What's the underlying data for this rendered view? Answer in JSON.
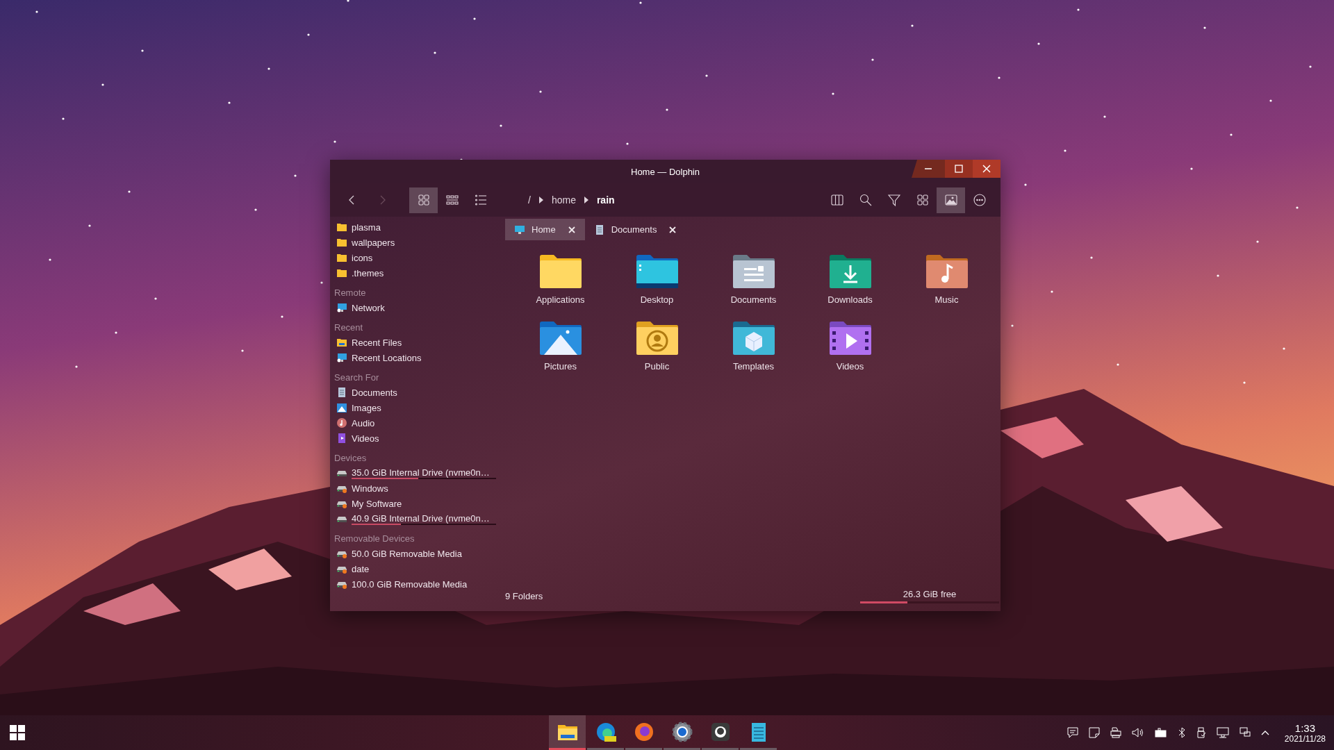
{
  "window": {
    "title": "Home — Dolphin"
  },
  "toolbar": {
    "view_modes": [
      {
        "kind": "icons",
        "selected": true
      },
      {
        "kind": "compact",
        "selected": false
      },
      {
        "kind": "details",
        "selected": false
      }
    ],
    "breadcrumb": [
      {
        "label": "/",
        "selected": false
      },
      {
        "label": "home",
        "selected": false
      },
      {
        "label": "rain",
        "selected": true
      }
    ],
    "tools": [
      {
        "kind": "split",
        "selected": false
      },
      {
        "kind": "search",
        "selected": false
      },
      {
        "kind": "filter",
        "selected": false
      },
      {
        "kind": "grid",
        "selected": false
      },
      {
        "kind": "preview",
        "selected": true
      },
      {
        "kind": "more",
        "selected": false
      }
    ]
  },
  "sidebar": {
    "sections": [
      {
        "items": [
          {
            "label": "plasma",
            "kind": "folder"
          },
          {
            "label": "wallpapers",
            "kind": "folder"
          },
          {
            "label": "icons",
            "kind": "folder"
          },
          {
            "label": ".themes",
            "kind": "folder"
          }
        ]
      },
      {
        "heading": "Remote",
        "items": [
          {
            "label": "Network",
            "kind": "network"
          }
        ]
      },
      {
        "heading": "Recent",
        "items": [
          {
            "label": "Recent Files",
            "kind": "recent-files"
          },
          {
            "label": "Recent Locations",
            "kind": "recent-locations"
          }
        ]
      },
      {
        "heading": "Search For",
        "items": [
          {
            "label": "Documents",
            "kind": "documents"
          },
          {
            "label": "Images",
            "kind": "images"
          },
          {
            "label": "Audio",
            "kind": "audio"
          },
          {
            "label": "Videos",
            "kind": "videos"
          }
        ]
      },
      {
        "heading": "Devices",
        "items": [
          {
            "label": "35.0 GiB Internal Drive (nvme0n…",
            "kind": "drive",
            "level": 0.46
          },
          {
            "label": "Windows",
            "kind": "drive-removable"
          },
          {
            "label": "My Software",
            "kind": "drive-removable"
          },
          {
            "label": "40.9 GiB Internal Drive (nvme0n…",
            "kind": "drive",
            "level": 0.34
          }
        ]
      },
      {
        "heading": "Removable Devices",
        "items": [
          {
            "label": "50.0 GiB Removable Media",
            "kind": "drive-removable"
          },
          {
            "label": "date",
            "kind": "drive-removable"
          },
          {
            "label": "100.0 GiB Removable Media",
            "kind": "drive-removable"
          }
        ]
      }
    ]
  },
  "tabs": [
    {
      "label": "Home",
      "kind": "desktop",
      "selected": true
    },
    {
      "label": "Documents",
      "kind": "documents",
      "selected": false
    }
  ],
  "folders": [
    {
      "label": "Applications",
      "kind": "applications"
    },
    {
      "label": "Desktop",
      "kind": "desktop"
    },
    {
      "label": "Documents",
      "kind": "documents"
    },
    {
      "label": "Downloads",
      "kind": "downloads"
    },
    {
      "label": "Music",
      "kind": "music"
    },
    {
      "label": "Pictures",
      "kind": "pictures"
    },
    {
      "label": "Public",
      "kind": "public"
    },
    {
      "label": "Templates",
      "kind": "templates"
    },
    {
      "label": "Videos",
      "kind": "videos"
    }
  ],
  "status_bar": {
    "summary": "9 Folders",
    "free_space": "26.3 GiB free",
    "level": 0.34
  },
  "taskbar": {
    "apps": [
      {
        "kind": "files",
        "selected": true
      },
      {
        "kind": "edge",
        "selected": false
      },
      {
        "kind": "firefox",
        "selected": false
      },
      {
        "kind": "settings",
        "selected": false
      },
      {
        "kind": "github",
        "selected": false
      },
      {
        "kind": "notes",
        "selected": false
      }
    ],
    "clock": {
      "time": "1:33",
      "date": "2021/11/28"
    }
  }
}
